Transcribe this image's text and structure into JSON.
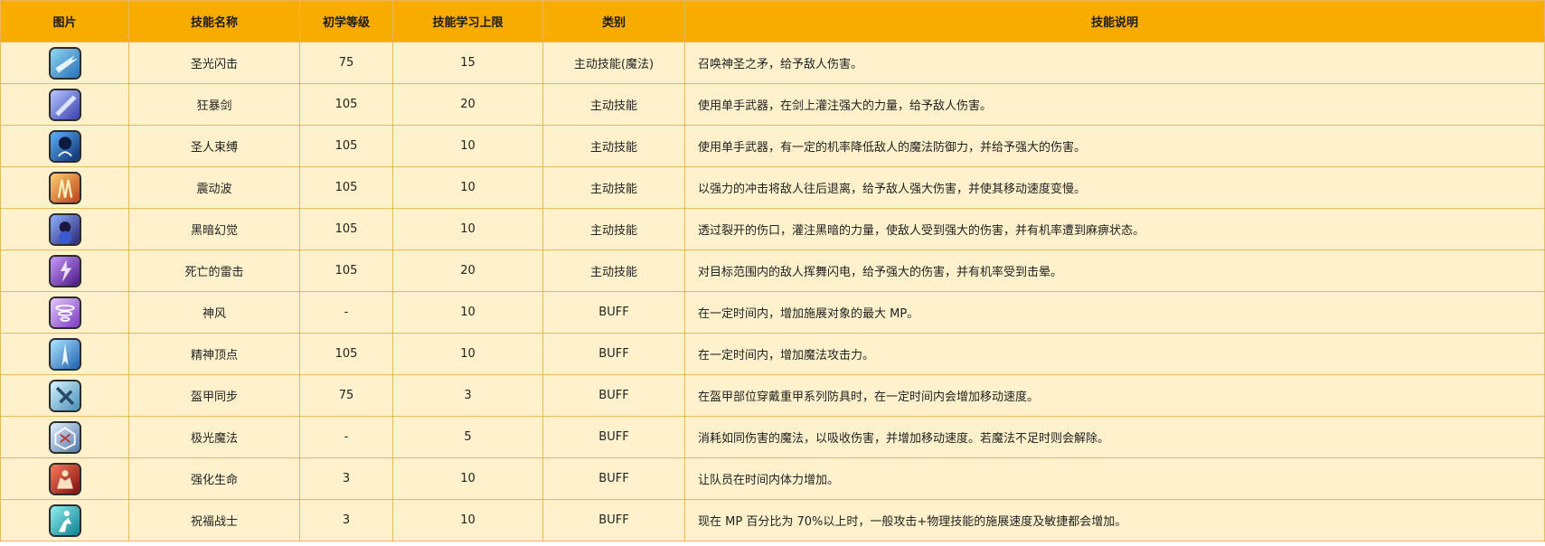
{
  "headers": {
    "icon": "图片",
    "name": "技能名称",
    "level": "初学等级",
    "max": "技能学习上限",
    "type": "类别",
    "desc": "技能说明"
  },
  "skills": [
    {
      "icon": "holy-flash-icon",
      "name": "圣光闪击",
      "level": "75",
      "max": "15",
      "type": "主动技能(魔法)",
      "desc": "召唤神圣之矛，给予敌人伤害。",
      "colors": [
        "#8fd8f0",
        "#2a6fb8"
      ]
    },
    {
      "icon": "berserk-sword-icon",
      "name": "狂暴剑",
      "level": "105",
      "max": "20",
      "type": "主动技能",
      "desc": "使用单手武器，在剑上灌注强大的力量，给予敌人伤害。",
      "colors": [
        "#b7c8ff",
        "#3a3fb0"
      ]
    },
    {
      "icon": "holy-bind-icon",
      "name": "圣人束缚",
      "level": "105",
      "max": "10",
      "type": "主动技能",
      "desc": "使用单手武器，有一定的机率降低敌人的魔法防御力，并给予强大的伤害。",
      "colors": [
        "#5bb4ff",
        "#0e2d6a"
      ]
    },
    {
      "icon": "shockwave-icon",
      "name": "震动波",
      "level": "105",
      "max": "10",
      "type": "主动技能",
      "desc": "以强力的冲击将敌人往后退离，给予敌人强大伤害，并使其移动速度变慢。",
      "colors": [
        "#ffd070",
        "#b8401c"
      ]
    },
    {
      "icon": "dark-illusion-icon",
      "name": "黑暗幻觉",
      "level": "105",
      "max": "10",
      "type": "主动技能",
      "desc": "透过裂开的伤口，灌注黑暗的力量，使敌人受到强大的伤害，并有机率遭到麻痹状态。",
      "colors": [
        "#8fb0ff",
        "#2a2670"
      ]
    },
    {
      "icon": "death-thunder-icon",
      "name": "死亡的雷击",
      "level": "105",
      "max": "20",
      "type": "主动技能",
      "desc": "对目标范围内的敌人挥舞闪电，给予强大的伤害，并有机率受到击晕。",
      "colors": [
        "#c79aff",
        "#4a1680"
      ]
    },
    {
      "icon": "divine-wind-icon",
      "name": "神风",
      "level": "-",
      "max": "10",
      "type": "BUFF",
      "desc": "在一定时间内，增加施展对象的最大 MP。",
      "colors": [
        "#e8c8ff",
        "#7a3ac0"
      ]
    },
    {
      "icon": "spirit-peak-icon",
      "name": "精神顶点",
      "level": "105",
      "max": "10",
      "type": "BUFF",
      "desc": "在一定时间内，增加魔法攻击力。",
      "colors": [
        "#aee6ff",
        "#1d5fb0"
      ]
    },
    {
      "icon": "armor-sync-icon",
      "name": "盔甲同步",
      "level": "75",
      "max": "3",
      "type": "BUFF",
      "desc": "在盔甲部位穿戴重甲系列防具时，在一定时间内会增加移动速度。",
      "colors": [
        "#d6f4ff",
        "#4a8fb8"
      ]
    },
    {
      "icon": "aurora-magic-icon",
      "name": "极光魔法",
      "level": "-",
      "max": "5",
      "type": "BUFF",
      "desc": "消耗如同伤害的魔法，以吸收伤害，并增加移动速度。若魔法不足时则会解除。",
      "colors": [
        "#e4f1ff",
        "#4f78a8"
      ]
    },
    {
      "icon": "enhance-life-icon",
      "name": "强化生命",
      "level": "3",
      "max": "10",
      "type": "BUFF",
      "desc": "让队员在时间内体力增加。",
      "colors": [
        "#ff7a5a",
        "#7a0e0e"
      ]
    },
    {
      "icon": "bless-warrior-icon",
      "name": "祝福战士",
      "level": "3",
      "max": "10",
      "type": "BUFF",
      "desc": "现在 MP 百分比为 70%以上时，一般攻击+物理技能的施展速度及敏捷都会增加。",
      "colors": [
        "#8ff0f0",
        "#0f7f8f"
      ]
    }
  ]
}
